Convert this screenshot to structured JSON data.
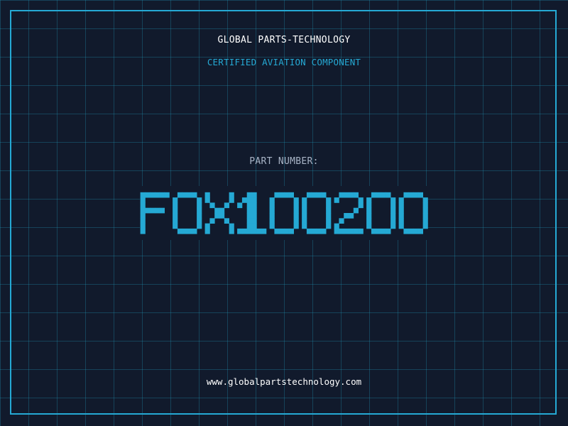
{
  "brand": "GLOBAL PARTS-TECHNOLOGY",
  "subtitle": "CERTIFIED AVIATION COMPONENT",
  "part_label": "PART NUMBER:",
  "part_number": "FOX100200",
  "url": "www.globalpartstechnology.com",
  "colors": {
    "background": "#111a2c",
    "grid": "#1f5f78",
    "accent": "#25a9d4",
    "label": "#a8b4c6",
    "text": "#ffffff"
  }
}
